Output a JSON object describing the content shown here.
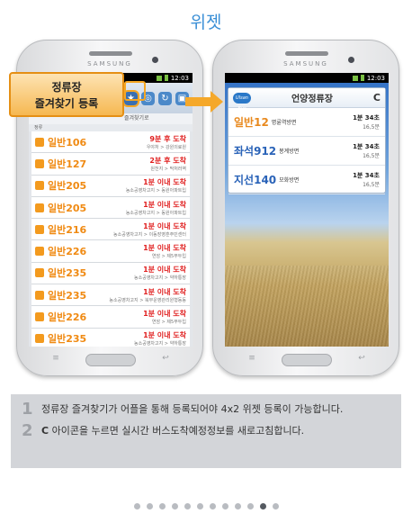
{
  "page_title": "위젯",
  "phone_brand": "SAMSUNG",
  "status_time": "12:03",
  "callout": {
    "line1": "정류장",
    "line2": "즐겨찾기 등록"
  },
  "left_screen": {
    "tab_label": "즐겨찾기로",
    "section_label": "정류",
    "rows": [
      {
        "route": "일반106",
        "eta": "9분 후 도착",
        "dir": "우야처 > 강원의료원"
      },
      {
        "route": "일반127",
        "eta": "2분 후 도착",
        "dir": "원천지 > 막처러역"
      },
      {
        "route": "일반205",
        "eta": "1분 이내 도착",
        "dir": "농소공영차고지 > 동원아파트입"
      },
      {
        "route": "일반205",
        "eta": "1분 이내 도착",
        "dir": "농소공영차고지 > 동원아파트입"
      },
      {
        "route": "일반216",
        "eta": "1분 이내 도착",
        "dir": "농소공영차고지 > 이동장영훈주민센터"
      },
      {
        "route": "일반226",
        "eta": "1분 이내 도착",
        "dir": "연암 > 제5부두입"
      },
      {
        "route": "일반235",
        "eta": "1분 이내 도착",
        "dir": "농소공영차고지 > 약하통장"
      },
      {
        "route": "일반235",
        "eta": "1분 이내 도착",
        "dir": "농소공영차고지 > 북부운영관리원형동동"
      },
      {
        "route": "일반226",
        "eta": "1분 이내 도착",
        "dir": "연암 > 제5부두입"
      },
      {
        "route": "일반235",
        "eta": "1분 이내 도착",
        "dir": "농소공영차고지 > 약하통장"
      }
    ]
  },
  "widget": {
    "logo": "Ulsan Bus",
    "title": "언양정류장",
    "rows": [
      {
        "type": "일반",
        "number": "12",
        "dest": "명륜역방면",
        "time": "1분 34초",
        "interval": "16,5분",
        "color": "#e8891e"
      },
      {
        "type": "좌석",
        "number": "912",
        "dest": "봉계방면",
        "time": "1분 34초",
        "interval": "16,5분",
        "color": "#2a63b8"
      },
      {
        "type": "지선",
        "number": "140",
        "dest": "모화방면",
        "time": "1분 34초",
        "interval": "16,5분",
        "color": "#2a63b8"
      }
    ]
  },
  "notes": [
    {
      "num": "1",
      "text": "정류장 즐겨찾기가 어플을 통해 등록되어야 4x2 위젯 등록이 가능합니다."
    },
    {
      "num": "2",
      "icon": "refresh-icon",
      "text": "아이콘을 누르면 실시간 버스도착예정정보를 새로고침합니다."
    }
  ],
  "pagination": {
    "total": 12,
    "current_index": 10
  }
}
